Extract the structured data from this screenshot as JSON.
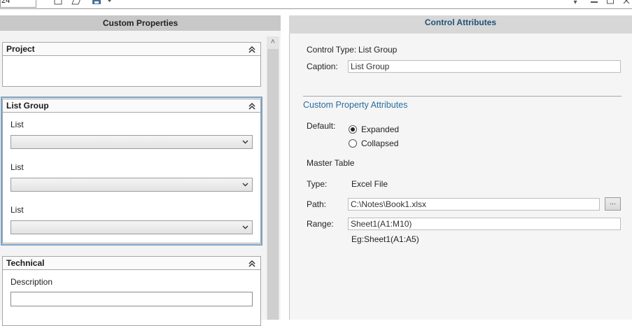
{
  "toolbar": {
    "doc_field_fragment": "24",
    "icons": [
      "new-document-icon",
      "open-document-icon",
      "save-icon"
    ],
    "window_controls": [
      "dropdown-icon",
      "minimize-icon",
      "maximize-icon",
      "close-icon"
    ]
  },
  "left_panel": {
    "title": "Custom Properties",
    "groups": [
      {
        "title": "Project",
        "fields": []
      },
      {
        "title": "List Group",
        "selected": true,
        "fields": [
          {
            "label": "List",
            "type": "dropdown",
            "value": ""
          },
          {
            "label": "List",
            "type": "dropdown",
            "value": ""
          },
          {
            "label": "List",
            "type": "dropdown",
            "value": ""
          }
        ]
      },
      {
        "title": "Technical",
        "fields": [
          {
            "label": "Description",
            "type": "textbox",
            "value": ""
          }
        ]
      }
    ]
  },
  "right_panel": {
    "title": "Control Attributes",
    "control_type_label": "Control Type:",
    "control_type_value": "List Group",
    "caption_label": "Caption:",
    "caption_value": "List Group",
    "section_title": "Custom Property Attributes",
    "default_label": "Default:",
    "default_options": [
      {
        "label": "Expanded",
        "checked": true
      },
      {
        "label": "Collapsed",
        "checked": false
      }
    ],
    "master_table_label": "Master Table",
    "type_label": "Type:",
    "type_value": "Excel File",
    "path_label": "Path:",
    "path_value": "C:\\Notes\\Book1.xlsx",
    "browse_label": "...",
    "range_label": "Range:",
    "range_value": "Sheet1(A1:M10)",
    "range_hint": "Eg:Sheet1(A1:A5)"
  },
  "colors": {
    "header_text": "#1f5377",
    "section_title": "#2a6e9e",
    "selection_outline": "#7da2c5"
  }
}
